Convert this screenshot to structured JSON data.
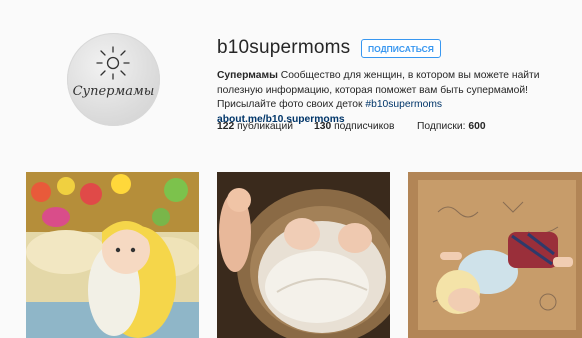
{
  "profile": {
    "avatar_text": "Супермамы",
    "username": "b10supermoms",
    "follow_label": "ПОДПИСАТЬСЯ",
    "bio": {
      "name": "Супермамы",
      "text": "Сообщество для женщин, в котором вы можете найти полезную информацию, которая поможет вам быть супермамой! Присылайте фото своих деток",
      "hashtag": "#b10supermoms",
      "link": "about.me/b10.supermoms"
    },
    "stats": {
      "posts_count": "122",
      "posts_label": "публикаций",
      "followers_count": "130",
      "followers_label": "подписчиков",
      "following_label": "Подписки:",
      "following_count": "600"
    }
  },
  "posts": [
    {
      "subject": "baby in yellow duck costume with toys"
    },
    {
      "subject": "twin babies sleeping in a basket"
    },
    {
      "subject": "baby lying in a cardboard box with drawings"
    }
  ],
  "colors": {
    "accent": "#3897f0",
    "link": "#003569",
    "background": "#fafafa"
  }
}
